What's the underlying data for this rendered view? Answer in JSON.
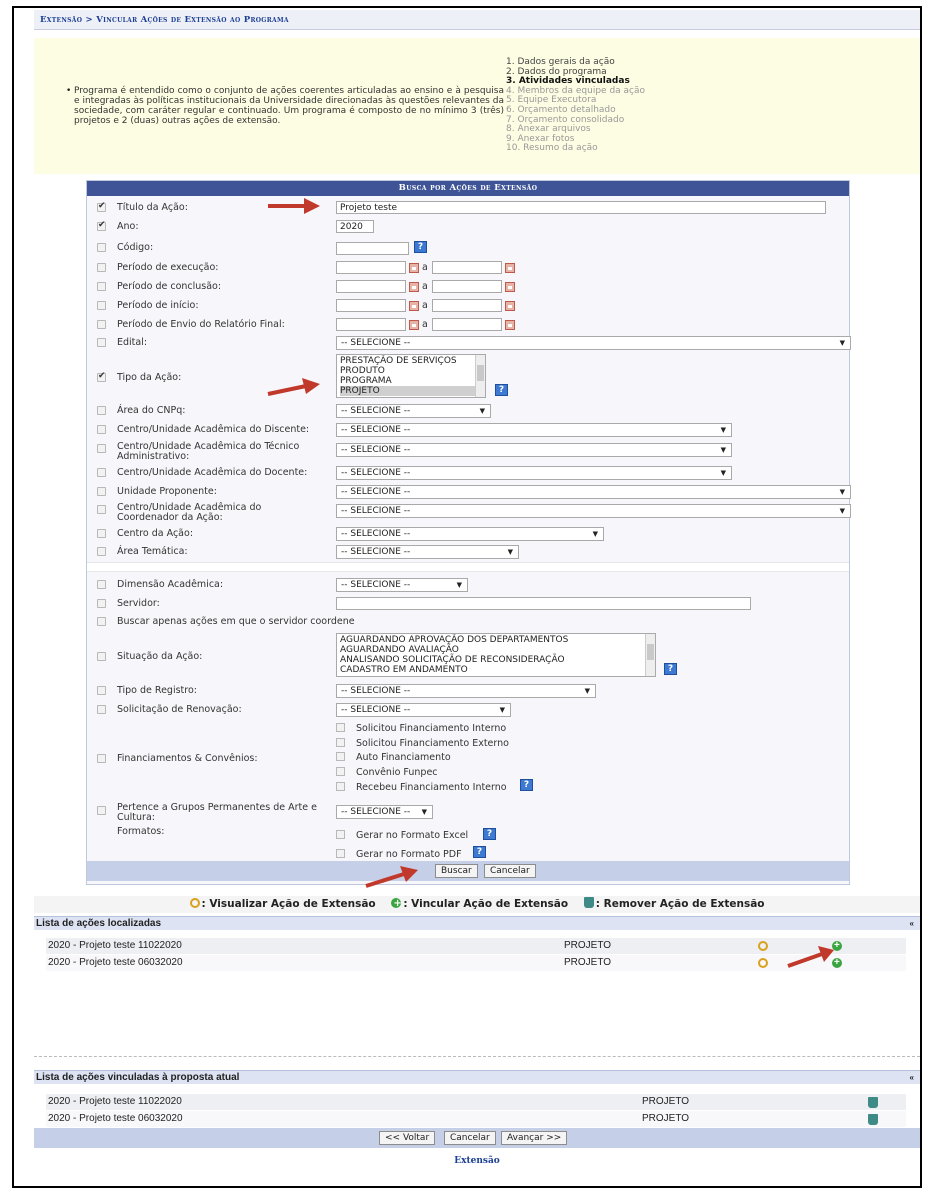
{
  "breadcrumb": "Extensão > Vincular Ações de Extensão ao Programa",
  "info": {
    "bullet": "•",
    "text": "Programa é entendido como o conjunto de ações coerentes articuladas ao ensino e à pesquisa e integradas às políticas institucionais da Universidade direcionadas às questões relevantes da sociedade, com caráter regular e continuado. Um programa é composto de no mínimo 3 (três) projetos e 2 (duas) outras ações de extensão.",
    "steps": [
      "1. Dados gerais da ação",
      "2. Dados do programa",
      "3. Atividades vinculadas",
      "4. Membros da equipe da ação",
      "5. Equipe Executora",
      "6. Orçamento detalhado",
      "7. Orçamento consolidado",
      "8. Anexar arquivos",
      "9. Anexar fotos",
      "10. Resumo da ação"
    ]
  },
  "form": {
    "title": "Busca por Ações de Extensão",
    "a_sep": "a",
    "labels": {
      "titulo": "Título da Ação:",
      "ano": "Ano:",
      "codigo": "Código:",
      "periodo_execucao": "Período de execução:",
      "periodo_conclusao": "Período de conclusão:",
      "periodo_inicio": "Período de início:",
      "periodo_relatorio": "Período de Envio do Relatório Final:",
      "edital": "Edital:",
      "tipo_acao": "Tipo da Ação:",
      "area_cnpq": "Área do CNPq:",
      "centro_discente": "Centro/Unidade Acadêmica do Discente:",
      "centro_tecnico": "Centro/Unidade Acadêmica do Técnico Administrativo:",
      "centro_docente": "Centro/Unidade Acadêmica do Docente:",
      "unidade_proponente": "Unidade Proponente:",
      "centro_coordenador": "Centro/Unidade Acadêmica do Coordenador da Ação:",
      "centro_acao": "Centro da Ação:",
      "area_tematica": "Área Temática:",
      "dimensao": "Dimensão Acadêmica:",
      "servidor": "Servidor:",
      "buscar_coordene": "Buscar apenas ações em que o servidor coordene",
      "situacao": "Situação da Ação:",
      "tipo_registro": "Tipo de Registro:",
      "solicitacao": "Solicitação de Renovação:",
      "financiamentos": "Financiamentos & Convênios:",
      "pertence": "Pertence a Grupos Permanentes de Arte e Cultura:",
      "formatos": "Formatos:"
    },
    "values": {
      "titulo": "Projeto teste",
      "ano": "2020",
      "select_default": "-- SELECIONE --"
    },
    "tipo_acao_options": [
      "PRESTAÇÃO DE SERVIÇOS",
      "PRODUTO",
      "PROGRAMA",
      "PROJETO"
    ],
    "situacao_options": [
      "AGUARDANDO APROVAÇÃO DOS DEPARTAMENTOS",
      "AGUARDANDO AVALIAÇÃO",
      "ANALISANDO SOLICITAÇÃO DE RECONSIDERAÇÃO",
      "CADASTRO EM ANDAMENTO"
    ],
    "financiamentos": [
      "Solicitou Financiamento Interno",
      "Solicitou Financiamento Externo",
      "Auto Financiamento",
      "Convênio Funpec",
      "Recebeu Financiamento Interno"
    ],
    "formatos": [
      "Gerar no Formato Excel",
      "Gerar no Formato PDF"
    ],
    "buttons": {
      "buscar": "Buscar",
      "cancelar": "Cancelar"
    },
    "help": "?"
  },
  "legend": {
    "visualizar": ": Visualizar Ação de Extensão",
    "vincular": ": Vincular Ação de Extensão",
    "remover": ": Remover Ação de Extensão"
  },
  "localizadas": {
    "title": "Lista de ações localizadas",
    "rows": [
      {
        "name": "2020 - Projeto teste 11022020",
        "tipo": "PROJETO"
      },
      {
        "name": "2020 - Projeto teste 06032020",
        "tipo": "PROJETO"
      }
    ]
  },
  "vinculadas": {
    "title": "Lista de ações vinculadas à proposta atual",
    "rows": [
      {
        "name": "2020 - Projeto teste 11022020",
        "tipo": "PROJETO"
      },
      {
        "name": "2020 - Projeto teste 06032020",
        "tipo": "PROJETO"
      }
    ]
  },
  "nav": {
    "voltar": "<< Voltar",
    "cancelar": "Cancelar",
    "avancar": "Avançar >>"
  },
  "footer": "Extensão",
  "colors": {
    "header_blue": "#3e5497",
    "arrow_red": "#c0392b",
    "info_bg": "#fdfde3"
  }
}
